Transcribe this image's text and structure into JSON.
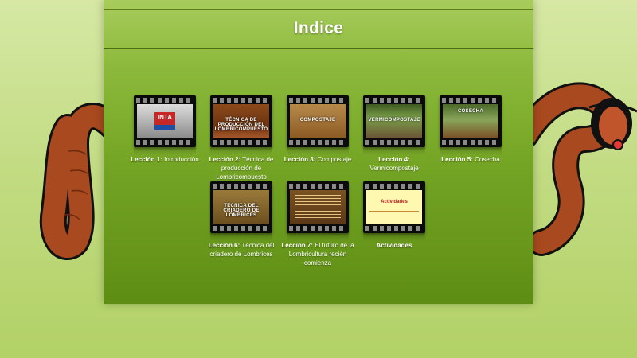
{
  "page": {
    "title": "Indice"
  },
  "lessons": [
    {
      "prefix": "Lección 1:",
      "text": "Introducción",
      "thumb_caption": ""
    },
    {
      "prefix": "Lección 2:",
      "text": "Técnica de producción de Lombricompuesto",
      "thumb_caption": "TÉCNICA DE PRODUCCIÓN DEL LOMBRICOMPUESTO"
    },
    {
      "prefix": "Lección 3:",
      "text": "Compostaje",
      "thumb_caption": "COMPOSTAJE"
    },
    {
      "prefix": "Lección 4:",
      "text": "Vermicompostaje",
      "thumb_caption": "VERMICOMPOSTAJE"
    },
    {
      "prefix": "Lección 5:",
      "text": "Cosecha",
      "thumb_caption": "COSECHA"
    },
    {
      "prefix": "Lección 6:",
      "text": "Técnica del criadero de Lombrices",
      "thumb_caption": "TÉCNICA DEL CRIADERO DE LOMBRICES"
    },
    {
      "prefix": "Lección 7:",
      "text": "El futuro de la Lombricultura recién comienza",
      "thumb_caption": ""
    },
    {
      "prefix": "Actividades",
      "text": "",
      "thumb_caption": "Actividades"
    }
  ],
  "logo_text": "INTA",
  "colors": {
    "panel_top": "#a7cc5c",
    "panel_bottom": "#5e8d14",
    "background": "#c3dc84",
    "worm": "#a8491f"
  }
}
